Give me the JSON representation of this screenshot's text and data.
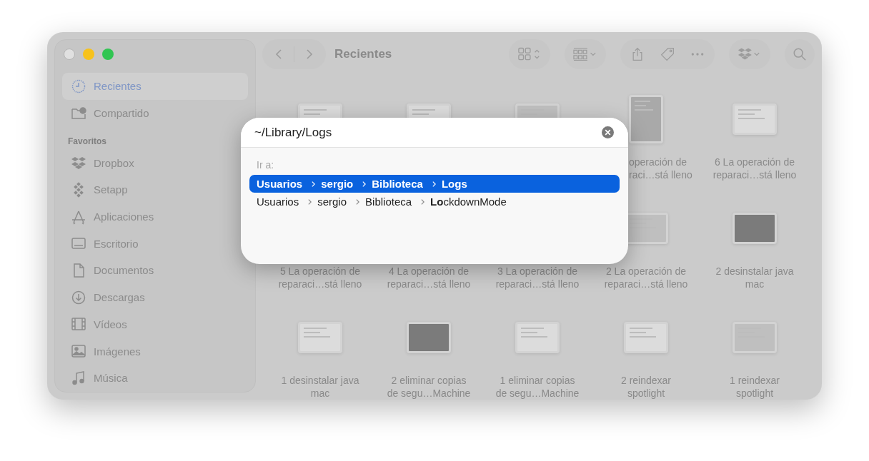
{
  "window": {
    "title": "Recientes"
  },
  "sidebar": {
    "items": [
      {
        "label": "Recientes",
        "selected": true
      },
      {
        "label": "Compartido",
        "selected": false
      }
    ],
    "favorites": {
      "heading": "Favoritos",
      "items": [
        {
          "label": "Dropbox",
          "selected": false
        },
        {
          "label": "Setapp",
          "selected": false
        },
        {
          "label": "Aplicaciones",
          "selected": false
        },
        {
          "label": "Escritorio",
          "selected": false
        },
        {
          "label": "Documentos",
          "selected": false
        },
        {
          "label": "Descargas",
          "selected": false
        },
        {
          "label": "Vídeos",
          "selected": false
        },
        {
          "label": "Imágenes",
          "selected": false
        },
        {
          "label": "Música",
          "selected": false
        }
      ]
    }
  },
  "grid": {
    "items": [
      {
        "kind": "covered"
      },
      {
        "kind": "covered"
      },
      {
        "kind": "covered"
      },
      {
        "kind": "partial",
        "label": [
          "operación de",
          "raci…stá lleno"
        ]
      },
      {
        "kind": "file",
        "label": [
          "6 La operación de",
          "reparaci…stá lleno"
        ]
      },
      {
        "kind": "label-only",
        "label": [
          "5 La operación de",
          "reparaci…stá lleno"
        ]
      },
      {
        "kind": "label-only",
        "label": [
          "4 La operación de",
          "reparaci…stá lleno"
        ]
      },
      {
        "kind": "label-only",
        "label": [
          "3 La operación de",
          "reparaci…stá lleno"
        ]
      },
      {
        "kind": "file",
        "label": [
          "2 La operación de",
          "reparaci…stá lleno"
        ]
      },
      {
        "kind": "file",
        "label": [
          "2 desinstalar java",
          "mac"
        ]
      },
      {
        "kind": "file",
        "label": [
          "1 desinstalar java",
          "mac"
        ]
      },
      {
        "kind": "file",
        "label": [
          "2 eliminar copias",
          "de segu…Machine"
        ]
      },
      {
        "kind": "file",
        "label": [
          "1 eliminar copias",
          "de segu…Machine"
        ]
      },
      {
        "kind": "file",
        "label": [
          "2 reindexar",
          "spotlight"
        ]
      },
      {
        "kind": "file",
        "label": [
          "1 reindexar",
          "spotlight"
        ]
      }
    ]
  },
  "goto_dialog": {
    "value": "~/Library/Logs",
    "section_label": "Ir a:",
    "results": [
      {
        "segments": [
          "Usuarios",
          "sergio",
          "Biblioteca",
          "**Logs**"
        ],
        "selected": true
      },
      {
        "segments": [
          "Usuarios",
          "sergio",
          "Biblioteca",
          "**Lo**ckdownMode"
        ],
        "selected": false
      }
    ]
  }
}
